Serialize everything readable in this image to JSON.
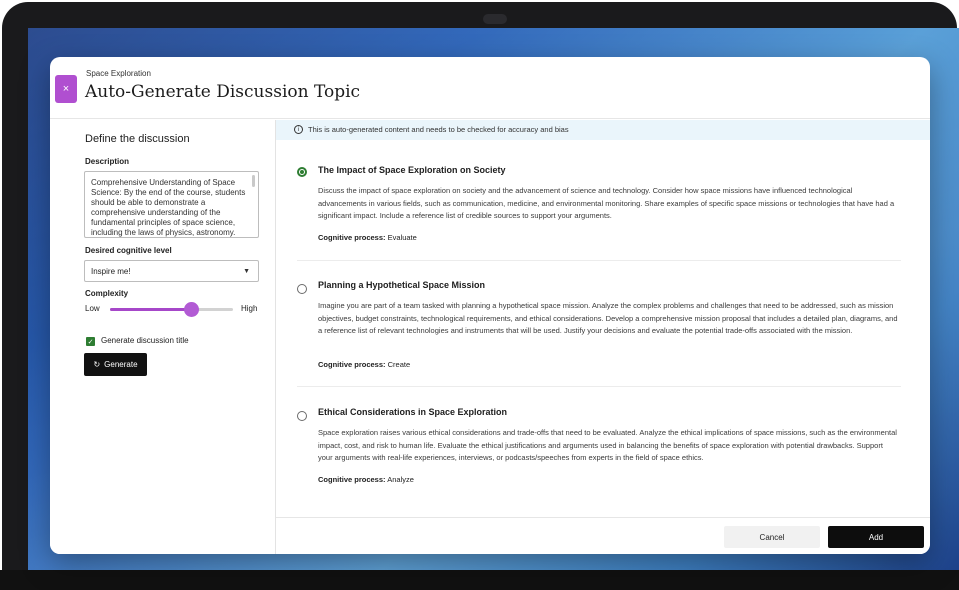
{
  "header": {
    "overline": "Space Exploration",
    "title": "Auto-Generate Discussion Topic",
    "close_symbol": "×"
  },
  "left_panel": {
    "title": "Define the discussion",
    "description_label": "Description",
    "description_value": "Comprehensive Understanding of Space Science: By the end of the course, students should be able to demonstrate a comprehensive understanding of the fundamental principles of space science, including the laws of physics, astronomy.",
    "cognitive_label": "Desired cognitive level",
    "cognitive_value": "Inspire me!",
    "complexity_label": "Complexity",
    "complexity_low": "Low",
    "complexity_high": "High",
    "complexity_level": 0.66,
    "generate_title_label": "Generate discussion title",
    "generate_title_checked": true,
    "generate_button": "Generate"
  },
  "notice": "This is auto-generated content and needs to be checked for accuracy and bias",
  "options": [
    {
      "title": "The Impact of Space Exploration on Society",
      "body": "Discuss the impact of space exploration on society and the advancement of science and technology. Consider how space missions have influenced technological advancements in various fields, such as communication, medicine, and environmental monitoring. Share examples of specific space missions or technologies that have had a significant impact. Include a reference list of credible sources to support your arguments.",
      "cognitive_label": "Cognitive process:",
      "cognitive_value": "Evaluate",
      "selected": true
    },
    {
      "title": "Planning a Hypothetical Space Mission",
      "body": "Imagine you are part of a team tasked with planning a hypothetical space mission. Analyze the complex problems and challenges that need to be addressed, such as mission objectives, budget constraints, technological requirements, and ethical considerations. Develop a comprehensive mission proposal that includes a detailed plan, diagrams, and a reference list of relevant technologies and instruments that will be used. Justify your decisions and evaluate the potential trade-offs associated with the mission.",
      "cognitive_label": "Cognitive process:",
      "cognitive_value": "Create",
      "selected": false
    },
    {
      "title": "Ethical Considerations in Space Exploration",
      "body": "Space exploration raises various ethical considerations and trade-offs that need to be evaluated. Analyze the ethical implications of space missions, such as the environmental impact, cost, and risk to human life. Evaluate the ethical justifications and arguments used in balancing the benefits of space exploration with potential drawbacks. Support your arguments with real-life experiences, interviews, or podcasts/speeches from experts in the field of space ethics.",
      "cognitive_label": "Cognitive process:",
      "cognitive_value": "Analyze",
      "selected": false
    }
  ],
  "footer": {
    "cancel": "Cancel",
    "add": "Add"
  }
}
